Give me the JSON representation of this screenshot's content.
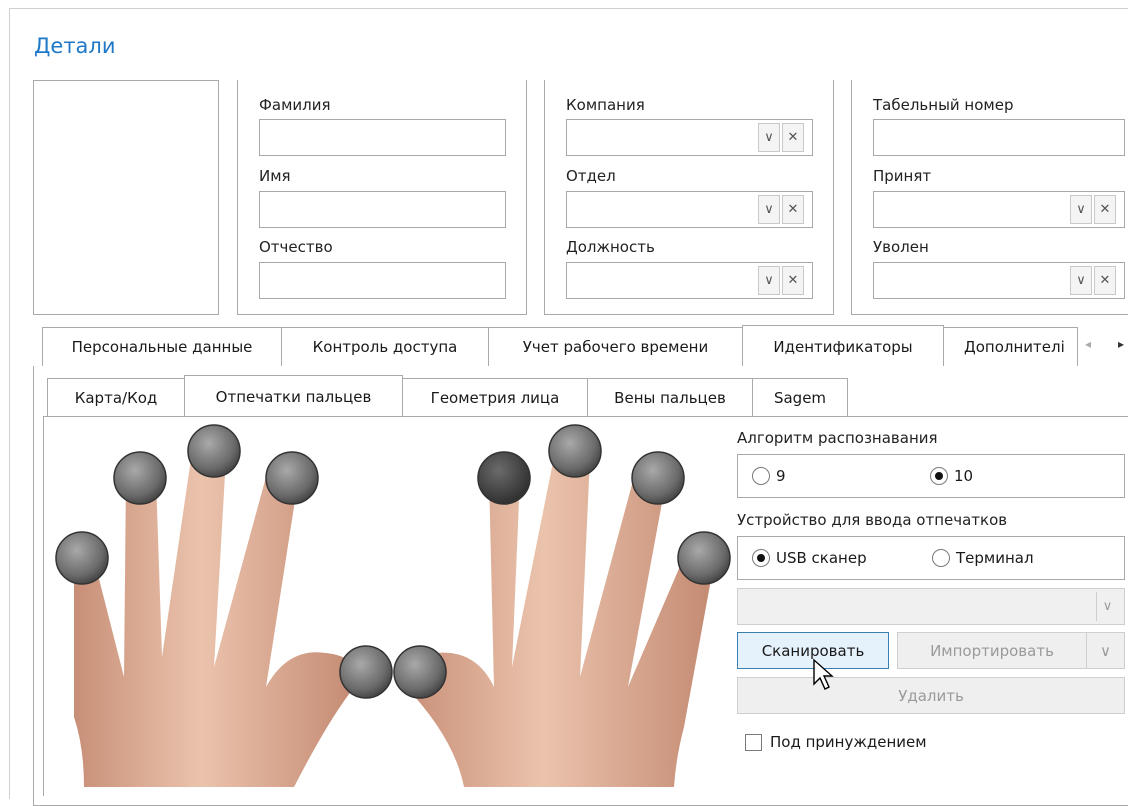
{
  "section_title": "Детали",
  "col1": {
    "last_name_label": "Фамилия",
    "first_name_label": "Имя",
    "patronymic_label": "Отчество"
  },
  "col2": {
    "company_label": "Компания",
    "department_label": "Отдел",
    "position_label": "Должность"
  },
  "col3": {
    "employee_number_label": "Табельный номер",
    "hired_label": "Принят",
    "fired_label": "Уволен"
  },
  "combo_icons": {
    "dropdown": "∨",
    "clear": "✕"
  },
  "main_tabs": [
    "Персональные данные",
    "Контроль доступа",
    "Учет рабочего времени",
    "Идентификаторы",
    "Дополнителі"
  ],
  "sub_tabs": [
    "Карта/Код",
    "Отпечатки пальцев",
    "Геометрия лица",
    "Вены пальцев",
    "Sagem"
  ],
  "algorithm": {
    "label": "Алгоритм распознавания",
    "options": [
      "9",
      "10"
    ],
    "selected": "10"
  },
  "device": {
    "label": "Устройство для ввода отпечатков",
    "options": [
      "USB сканер",
      "Терминал"
    ],
    "selected": "USB сканер"
  },
  "buttons": {
    "scan": "Сканировать",
    "import": "Импортировать",
    "delete": "Удалить"
  },
  "duress": {
    "label": "Под принуждением",
    "checked": false
  },
  "colors": {
    "accent": "#1e78c8",
    "skin": "#e7b9a2"
  }
}
